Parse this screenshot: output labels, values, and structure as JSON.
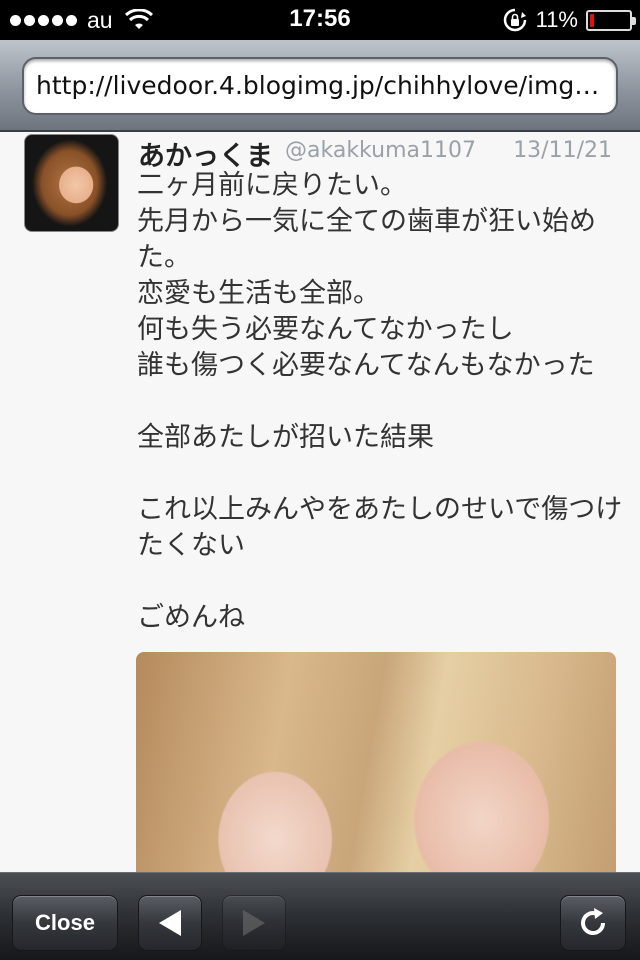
{
  "status_bar": {
    "carrier": "au",
    "time": "17:56",
    "battery_percent": "11%",
    "battery_level": 0.11,
    "battery_color": "#e11111"
  },
  "browser": {
    "url": "http://livedoor.4.blogimg.jp/chihhylove/img…"
  },
  "tweet": {
    "display_name": "あかっくま",
    "handle": "@akakkuma1107",
    "date": "13/11/21",
    "text": "二ヶ月前に戻りたい。\n先月から一気に全ての歯車が狂い始めた。\n恋愛も生活も全部。\n何も失う必要なんてなかったし\n誰も傷つく必要なんてなんもなかった\n\n全部あたしが招いた結果\n\nこれ以上みんやをあたしのせいで傷つけたくない\n\nごめんね"
  },
  "toolbar": {
    "close_label": "Close",
    "back_icon": "back-arrow-icon",
    "forward_icon": "forward-arrow-icon",
    "refresh_icon": "refresh-icon"
  }
}
